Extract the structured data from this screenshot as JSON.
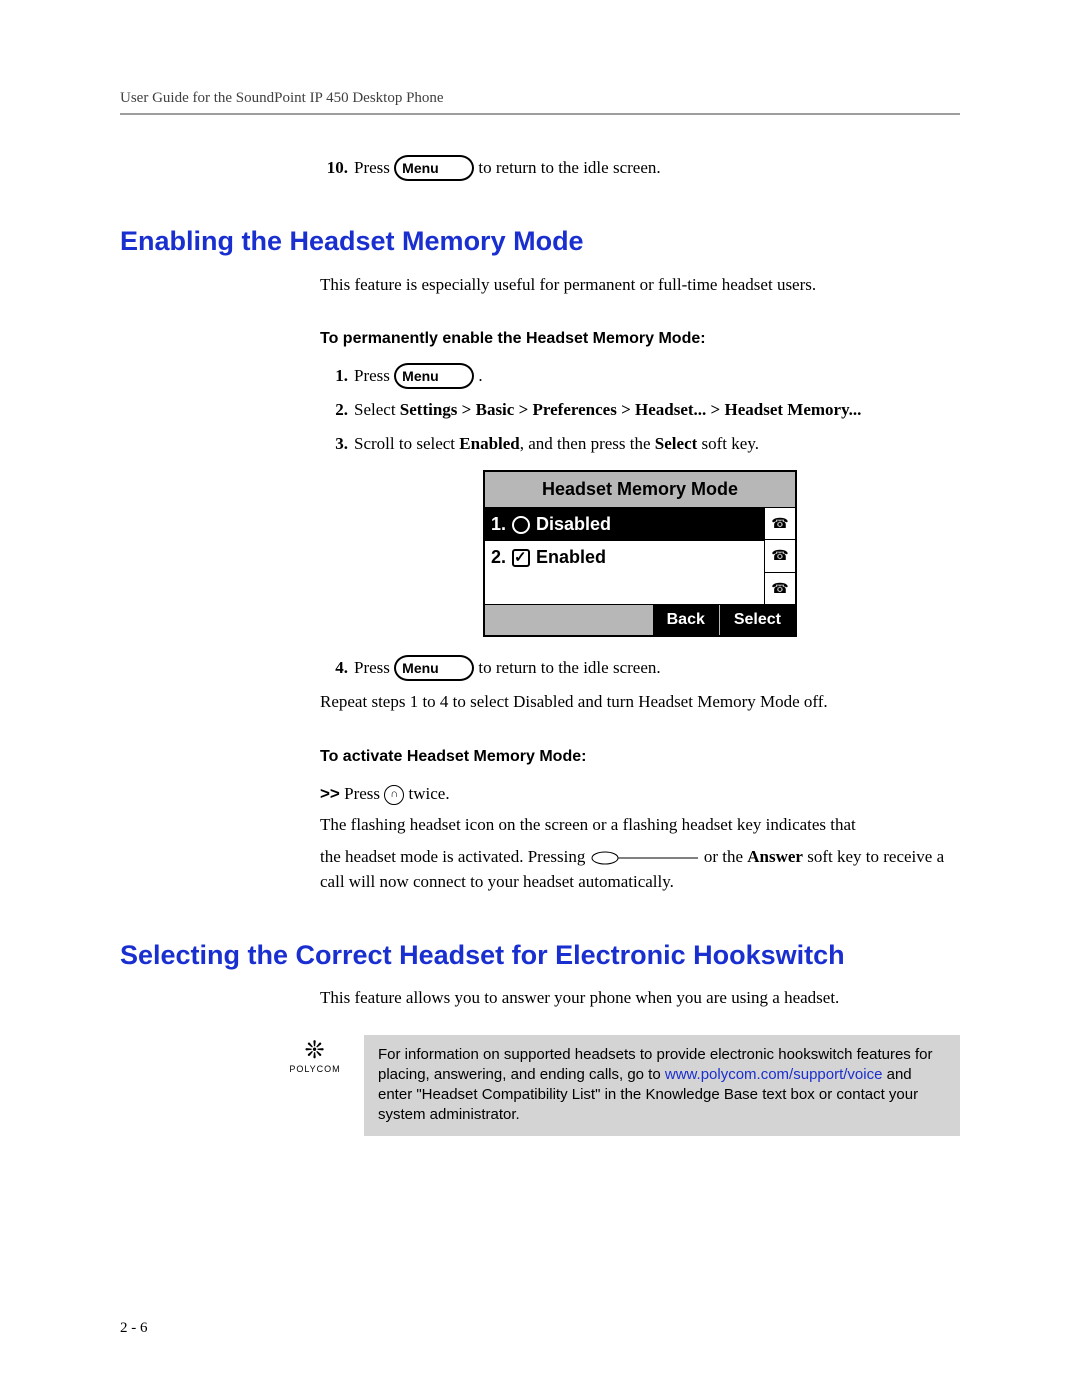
{
  "header": {
    "title": "User Guide for the SoundPoint IP 450 Desktop Phone"
  },
  "step10": {
    "num": "10.",
    "pre": "Press",
    "key": "Menu",
    "post": "to return to the idle screen."
  },
  "section1": {
    "heading": "Enabling the Headset Memory Mode",
    "intro": "This feature is especially useful for permanent or full-time headset users.",
    "lead": "To permanently enable the Headset Memory Mode:",
    "s1": {
      "num": "1.",
      "pre": "Press",
      "key": "Menu",
      "post": "."
    },
    "s2": {
      "num": "2.",
      "pre": "Select ",
      "bold": "Settings > Basic > Preferences > Headset... > Headset Memory..."
    },
    "s3": {
      "num": "3.",
      "a": "Scroll to select ",
      "b": "Enabled",
      "c": ", and then press the ",
      "d": "Select",
      "e": " soft key."
    },
    "screen": {
      "title": "Headset Memory Mode",
      "row1": {
        "num": "1.",
        "label": "Disabled"
      },
      "row2": {
        "num": "2.",
        "label": "Enabled"
      },
      "sk_back": "Back",
      "sk_select": "Select"
    },
    "s4": {
      "num": "4.",
      "pre": "Press",
      "key": "Menu",
      "post": "to return to the idle screen."
    },
    "repeat": "Repeat steps 1 to 4 to select Disabled and turn Headset Memory Mode off.",
    "lead2": "To activate Headset Memory Mode:",
    "act": {
      "chev": ">>",
      "a": "Press ",
      "b": " twice."
    },
    "flash1": "The flashing headset icon on the screen or a flashing headset key indicates that",
    "flash2a": "the headset mode is activated. Pressing ",
    "flash2b": " or the ",
    "flash2c": "Answer",
    "flash2d": " soft key to receive a call will now connect to your headset automatically."
  },
  "section2": {
    "heading": "Selecting the Correct Headset for Electronic Hookswitch",
    "intro": "This feature allows you to answer your phone when you are using a headset.",
    "logo": "POLYCOM",
    "note_a": "For information on supported headsets to provide electronic hookswitch features for placing, answering, and ending calls, go to ",
    "note_link": "www.polycom.com/support/voice",
    "note_b": " and enter \"Headset Compatibility List\" in the Knowledge Base text box or contact your system administrator."
  },
  "pagenum": "2 - 6",
  "chart_data": {
    "type": "table",
    "title": "Headset Memory Mode",
    "options": [
      {
        "index": 1,
        "label": "Disabled",
        "selected": true,
        "checked": false
      },
      {
        "index": 2,
        "label": "Enabled",
        "selected": false,
        "checked": true
      }
    ],
    "softkeys": [
      "Back",
      "Select"
    ]
  }
}
